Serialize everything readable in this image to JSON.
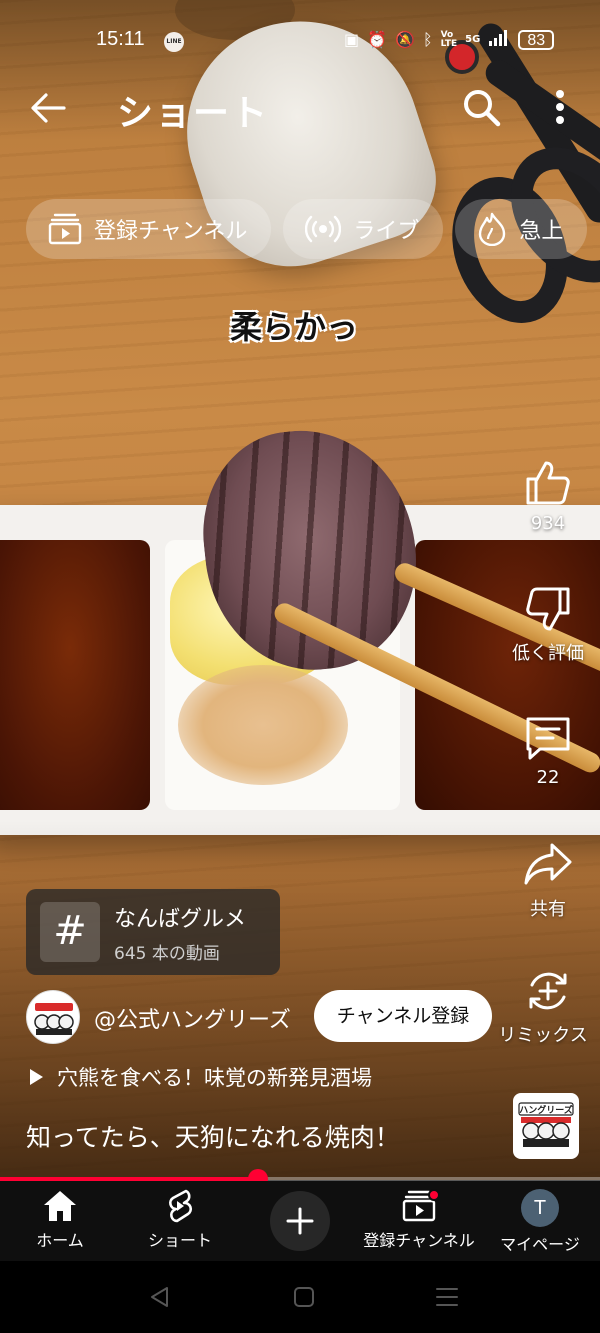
{
  "status_bar": {
    "time": "15:11",
    "notification_app": "LINE",
    "network": "5G",
    "battery": "83",
    "icons": [
      "nfc-icon",
      "alarm-icon",
      "mute-icon",
      "bluetooth-icon",
      "volte-icon",
      "signal-icon",
      "battery-icon"
    ]
  },
  "header": {
    "title": "ショート"
  },
  "chips": [
    {
      "label": "登録チャンネル",
      "icon": "subscriptions-icon"
    },
    {
      "label": "ライブ",
      "icon": "live-icon"
    },
    {
      "label": "急上",
      "icon": "trending-icon"
    }
  ],
  "video": {
    "caption_overlay": "柔らかっ",
    "title": "知ってたら、天狗になれる焼肉！",
    "playlist": "穴熊を食べる！味覚の新発見酒場",
    "progress": 0.43
  },
  "actions": {
    "like_count": "934",
    "dislike_label": "低く評価",
    "comment_count": "22",
    "share_label": "共有",
    "remix_label": "リミックス"
  },
  "hashtag": {
    "name": "なんばグルメ",
    "count": "645 本の動画"
  },
  "channel": {
    "handle": "@公式ハングリーズ",
    "subscribe_label": "チャンネル登録",
    "logo_text": "ハングリーズ"
  },
  "bottom_nav": {
    "items": [
      {
        "label": "ホーム",
        "icon": "home-icon"
      },
      {
        "label": "ショート",
        "icon": "shorts-icon"
      },
      {
        "label": "",
        "icon": "create-icon"
      },
      {
        "label": "登録チャンネル",
        "icon": "subscriptions-icon"
      },
      {
        "label": "マイページ",
        "icon": "avatar"
      }
    ],
    "avatar_initial": "T"
  },
  "colors": {
    "accent": "#ff0033",
    "nav_background": "#0f0f0f",
    "avatar": "#4c6173"
  }
}
